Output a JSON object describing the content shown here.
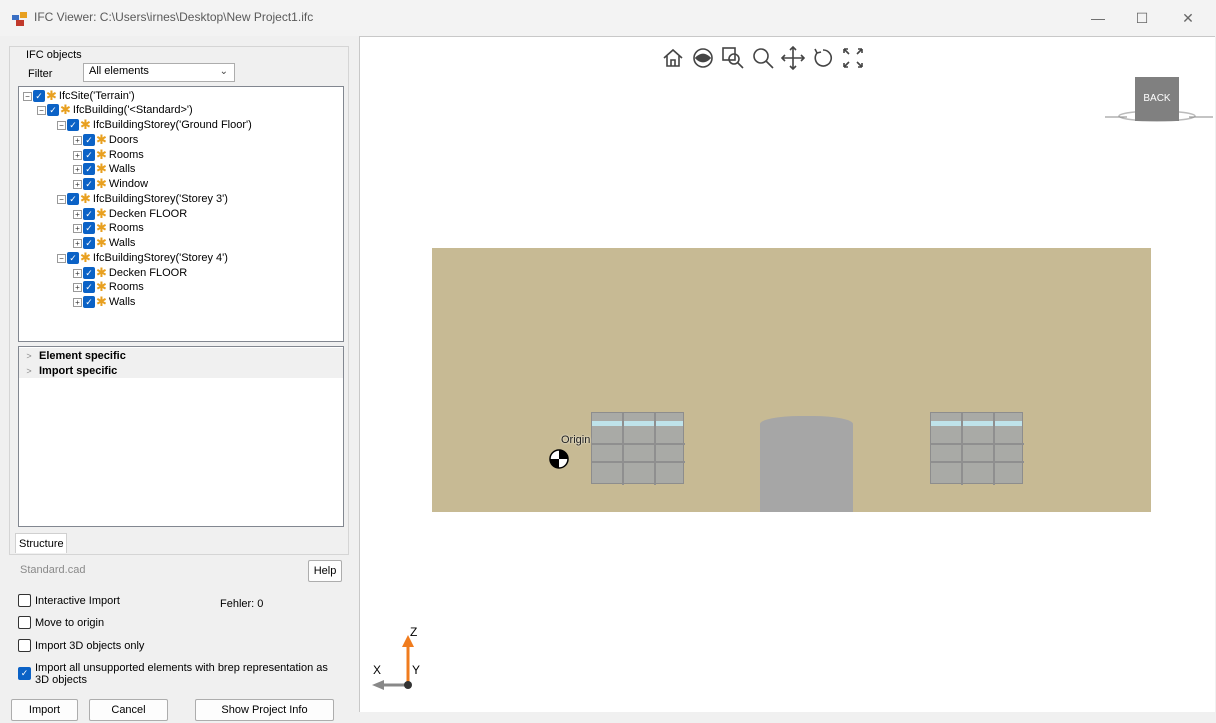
{
  "window": {
    "title": "IFC Viewer: C:\\Users\\irnes\\Desktop\\New Project1.ifc",
    "minimize": "—",
    "maximize": "☐",
    "close": "✕"
  },
  "left": {
    "group_title": "IFC objects",
    "filter_label": "Filter",
    "filter_value": "All elements",
    "tree": [
      {
        "label": "IfcSite('Terrain')"
      },
      {
        "label": "IfcBuilding('<Standard>')"
      },
      {
        "label": "IfcBuildingStorey('Ground Floor')"
      },
      {
        "label": "Doors"
      },
      {
        "label": "Rooms"
      },
      {
        "label": "Walls"
      },
      {
        "label": "Window"
      },
      {
        "label": "IfcBuildingStorey('Storey 3')"
      },
      {
        "label": "Decken FLOOR"
      },
      {
        "label": "Rooms"
      },
      {
        "label": "Walls"
      },
      {
        "label": "IfcBuildingStorey('Storey 4')"
      },
      {
        "label": "Decken FLOOR"
      },
      {
        "label": "Rooms"
      },
      {
        "label": "Walls"
      }
    ],
    "properties": [
      {
        "label": "Element specific"
      },
      {
        "label": "Import specific"
      }
    ],
    "tab": "Structure",
    "cad_file": "Standard.cad",
    "help_button": "Help",
    "options": [
      {
        "label": "Interactive Import",
        "checked": false
      },
      {
        "label": "Move to origin",
        "checked": false
      },
      {
        "label": "Import 3D objects only",
        "checked": false
      },
      {
        "label": "Import all unsupported elements with brep representation as 3D objects",
        "checked": true
      }
    ],
    "fehler": "Fehler: 0",
    "buttons": {
      "import": "Import",
      "cancel": "Cancel",
      "project_info": "Show Project Info"
    }
  },
  "viewport": {
    "toolbar": [
      "home-icon",
      "eye-icon",
      "zoom-window-icon",
      "zoom-icon",
      "pan-icon",
      "rotate-icon",
      "fullscreen-icon"
    ],
    "cube_label": "BACK",
    "origin_label": "Origin",
    "axes": {
      "x": "X",
      "y": "Y",
      "z": "Z"
    },
    "colors": {
      "facade": "#c7ba94",
      "glass": "#bfe3ea",
      "z_axis": "#f07c1e"
    }
  }
}
